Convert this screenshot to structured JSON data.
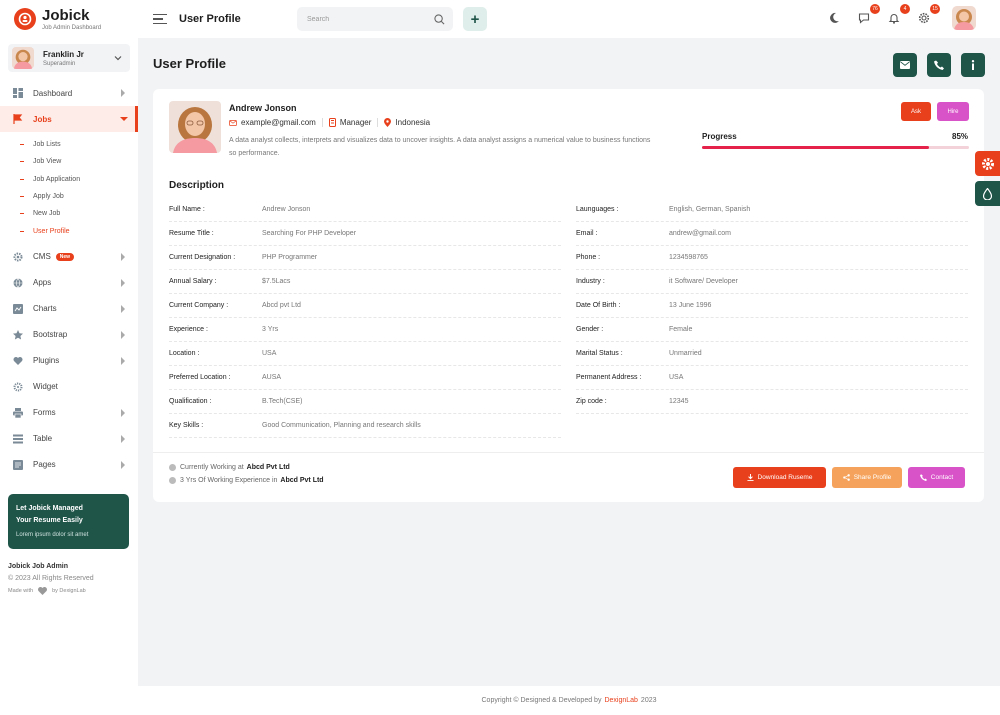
{
  "brand": {
    "name": "Jobick",
    "tagline": "Job Admin Dashboard"
  },
  "topbar": {
    "title": "User Profile",
    "search_placeholder": "Search",
    "badges": {
      "messages": "76",
      "notifications": "4",
      "settings": "15"
    }
  },
  "sidebar": {
    "user": {
      "name": "Franklin Jr",
      "role": "Superadmin"
    },
    "items": [
      {
        "label": "Dashboard"
      },
      {
        "label": "Jobs"
      },
      {
        "label": "CMS",
        "badge": "New"
      },
      {
        "label": "Apps"
      },
      {
        "label": "Charts"
      },
      {
        "label": "Bootstrap"
      },
      {
        "label": "Plugins"
      },
      {
        "label": "Widget"
      },
      {
        "label": "Forms"
      },
      {
        "label": "Table"
      },
      {
        "label": "Pages"
      }
    ],
    "jobs_sub": [
      "Job Lists",
      "Job View",
      "Job Application",
      "Apply Job",
      "New Job",
      "User Profile"
    ],
    "promo": {
      "title_line1": "Let Jobick Managed",
      "title_line2": "Your Resume Easily",
      "subtitle": "Lorem ipsum dolor sit amet"
    },
    "footer": {
      "app": "Jobick Job Admin",
      "copyright": "© 2023 All Rights Reserved",
      "made_with": "Made with",
      "by": "by DexignLab"
    }
  },
  "page": {
    "title": "User Profile"
  },
  "profile": {
    "name": "Andrew Jonson",
    "email": "example@gmail.com",
    "role": "Manager",
    "location": "Indonesia",
    "description": "A data analyst collects, interprets and visualizes data to uncover insights. A data analyst assigns a numerical value to business functions so performance.",
    "ask_label": "Ask",
    "hire_label": "Hire",
    "progress_label": "Progress",
    "progress_value": "85%",
    "progress_fraction": 0.85
  },
  "details": {
    "heading": "Description",
    "left": [
      {
        "k": "Full Name :",
        "v": "Andrew Jonson"
      },
      {
        "k": "Resume Title :",
        "v": "Searching For PHP Developer"
      },
      {
        "k": "Current Designation :",
        "v": "PHP Programmer"
      },
      {
        "k": "Annual Salary :",
        "v": "$7.5Lacs"
      },
      {
        "k": "Current Company :",
        "v": "Abcd pvt Ltd"
      },
      {
        "k": "Experience :",
        "v": "3 Yrs"
      },
      {
        "k": "Location :",
        "v": "USA"
      },
      {
        "k": "Preferred Location :",
        "v": "AUSA"
      },
      {
        "k": "Qualification :",
        "v": "B.Tech(CSE)"
      },
      {
        "k": "Key Skills :",
        "v": "Good Communication, Planning and research skills"
      }
    ],
    "right": [
      {
        "k": "Launguages :",
        "v": "English, German, Spanish"
      },
      {
        "k": "Email :",
        "v": "andrew@gmail.com"
      },
      {
        "k": "Phone :",
        "v": "1234598765"
      },
      {
        "k": "Industry :",
        "v": "it Software/ Developer"
      },
      {
        "k": "Date Of Birth :",
        "v": "13 June 1996"
      },
      {
        "k": "Gender :",
        "v": "Female"
      },
      {
        "k": "Marital Status :",
        "v": "Unmarried"
      },
      {
        "k": "Permanent Address :",
        "v": "USA"
      },
      {
        "k": "Zip code :",
        "v": "12345"
      }
    ]
  },
  "work": {
    "line1_prefix": "Currently Working at",
    "line1_company": "Abcd Pvt Ltd",
    "line2_prefix": "3 Yrs Of Working Experience in",
    "line2_company": "Abcd Pvt Ltd"
  },
  "actions": {
    "download": "Download Ruseme",
    "share": "Share Profile",
    "contact": "Contact"
  },
  "footer": {
    "text": "Copyright © Designed & Developed by",
    "link": "DexignLab",
    "year": "2023"
  },
  "colors": {
    "accent": "#e8401c",
    "primary": "#1f5449",
    "progress": "#e5234a",
    "hire": "#d953c8",
    "share": "#f5a35c"
  }
}
